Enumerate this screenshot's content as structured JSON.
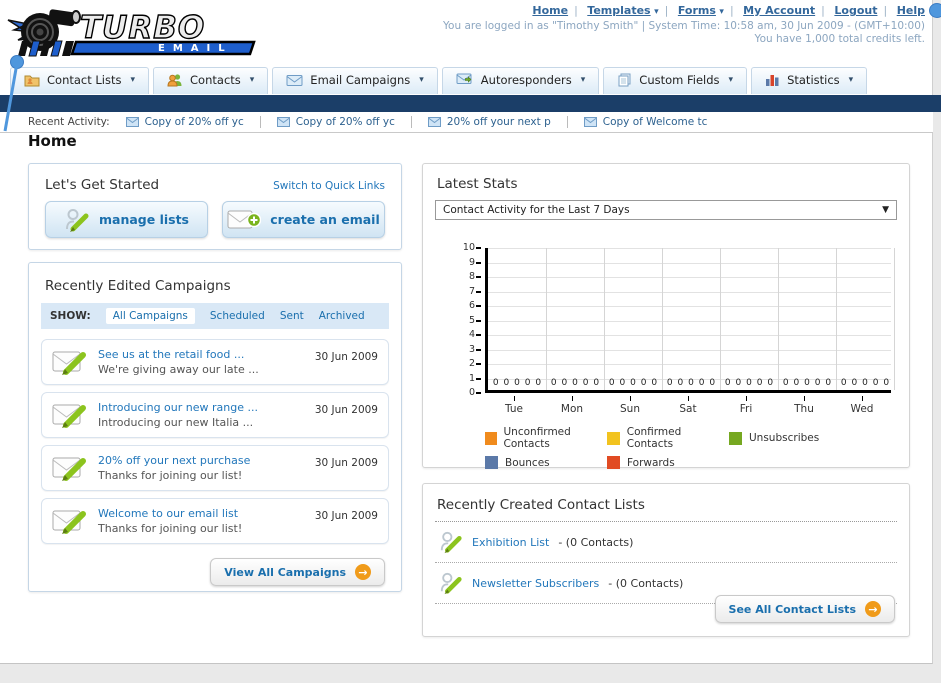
{
  "brand": {
    "line1": "TURBO",
    "line2": "EMAIL"
  },
  "header": {
    "links": [
      {
        "label": "Home",
        "dropdown": false
      },
      {
        "label": "Templates",
        "dropdown": true
      },
      {
        "label": "Forms",
        "dropdown": true
      },
      {
        "label": "My Account",
        "dropdown": false
      },
      {
        "label": "Logout",
        "dropdown": false
      },
      {
        "label": "Help",
        "dropdown": false
      }
    ],
    "login_info": "You are logged in as \"Timothy Smith\" | System Time: 10:58 am, 30 Jun 2009 - (GMT+10:00)",
    "credits_info": "You have 1,000 total credits left."
  },
  "nav": {
    "tabs": [
      {
        "label": "Contact Lists",
        "icon": "folder-icon"
      },
      {
        "label": "Contacts",
        "icon": "people-icon"
      },
      {
        "label": "Email Campaigns",
        "icon": "envelope-icon"
      },
      {
        "label": "Autoresponders",
        "icon": "envelope-arrow-icon"
      },
      {
        "label": "Custom Fields",
        "icon": "pages-icon"
      },
      {
        "label": "Statistics",
        "icon": "bar-chart-icon"
      }
    ]
  },
  "recent_activity": {
    "label": "Recent Activity:",
    "items": [
      "Copy of 20% off yc",
      "Copy of 20% off yc",
      "20% off your next p",
      "Copy of Welcome tc"
    ]
  },
  "page": {
    "title": "Home"
  },
  "get_started": {
    "title": "Let's Get Started",
    "switch_link": "Switch to Quick Links",
    "manage_lists_button": "manage lists",
    "create_email_button": "create an email"
  },
  "campaigns": {
    "title": "Recently Edited Campaigns",
    "show_label": "SHOW:",
    "filters": [
      "All Campaigns",
      "Scheduled",
      "Sent",
      "Archived"
    ],
    "active_filter": "All Campaigns",
    "items": [
      {
        "title": "See us at the retail food ...",
        "subtitle": "We're giving away our late ...",
        "date": "30 Jun 2009"
      },
      {
        "title": "Introducing our new range ...",
        "subtitle": "Introducing our new Italia ...",
        "date": "30 Jun 2009"
      },
      {
        "title": "20% off your next purchase",
        "subtitle": "Thanks for joining our list!",
        "date": "30 Jun 2009"
      },
      {
        "title": "Welcome to our email list",
        "subtitle": "Thanks for joining our list!",
        "date": "30 Jun 2009"
      }
    ],
    "view_all_button": "View All Campaigns"
  },
  "stats": {
    "title": "Latest Stats",
    "period_selector": "Contact Activity for the Last 7 Days"
  },
  "chart_data": {
    "type": "bar",
    "title": "Contact Activity for the Last 7 Days",
    "categories": [
      "Tue",
      "Mon",
      "Sun",
      "Sat",
      "Fri",
      "Thu",
      "Wed"
    ],
    "series": [
      {
        "name": "Unconfirmed Contacts",
        "color": "#f08b1d",
        "values": [
          0,
          0,
          0,
          0,
          0,
          0,
          0
        ]
      },
      {
        "name": "Confirmed Contacts",
        "color": "#f2c31f",
        "values": [
          0,
          0,
          0,
          0,
          0,
          0,
          0
        ]
      },
      {
        "name": "Unsubscribes",
        "color": "#76a821",
        "values": [
          0,
          0,
          0,
          0,
          0,
          0,
          0
        ]
      },
      {
        "name": "Bounces",
        "color": "#5b79a8",
        "values": [
          0,
          0,
          0,
          0,
          0,
          0,
          0
        ]
      },
      {
        "name": "Forwards",
        "color": "#e14b23",
        "values": [
          0,
          0,
          0,
          0,
          0,
          0,
          0
        ]
      }
    ],
    "ylim": [
      0,
      10
    ],
    "ytick_step": 1,
    "grid": true,
    "legend_position": "bottom",
    "data_labels_shown": true
  },
  "contact_lists": {
    "title": "Recently Created Contact Lists",
    "items": [
      {
        "name": "Exhibition List",
        "suffix": "- (0 Contacts)"
      },
      {
        "name": "Newsletter Subscribers",
        "suffix": "- (0 Contacts)"
      }
    ],
    "see_all_button": "See All Contact Lists"
  }
}
